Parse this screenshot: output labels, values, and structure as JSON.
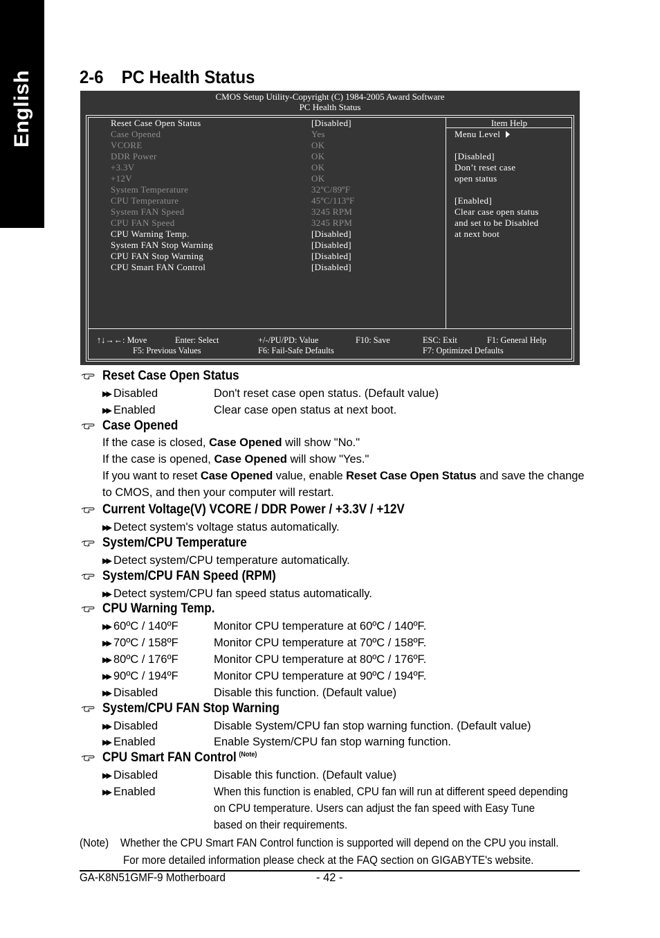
{
  "side_tab": {
    "label": "English"
  },
  "section": {
    "number": "2-6",
    "title": "PC Health Status"
  },
  "bios": {
    "header_line1": "CMOS Setup Utility-Copyright (C) 1984-2005 Award Software",
    "header_line2": "PC Health Status",
    "items": [
      {
        "label": "Reset Case Open Status",
        "value": "[Disabled]",
        "dim": false
      },
      {
        "label": "Case Opened",
        "value": "Yes",
        "dim": true
      },
      {
        "label": "VCORE",
        "value": "OK",
        "dim": true
      },
      {
        "label": "DDR Power",
        "value": "OK",
        "dim": true
      },
      {
        "label": "+3.3V",
        "value": "OK",
        "dim": true
      },
      {
        "label": "+12V",
        "value": "OK",
        "dim": true
      },
      {
        "label": "System Temperature",
        "value": "32ºC/89ºF",
        "dim": true
      },
      {
        "label": "CPU Temperature",
        "value": "45ºC/113ºF",
        "dim": true
      },
      {
        "label": "System FAN Speed",
        "value": "3245 RPM",
        "dim": true
      },
      {
        "label": "CPU FAN Speed",
        "value": "3245 RPM",
        "dim": true
      },
      {
        "label": "CPU Warning Temp.",
        "value": "[Disabled]",
        "dim": false
      },
      {
        "label": "System FAN Stop Warning",
        "value": "[Disabled]",
        "dim": false
      },
      {
        "label": "CPU FAN Stop Warning",
        "value": "[Disabled]",
        "dim": false
      },
      {
        "label": "CPU Smart FAN Control",
        "value": "[Disabled]",
        "dim": false
      }
    ],
    "help_title": "Item Help",
    "help_menu_level": "Menu Level",
    "help_lines": [
      "",
      "[Disabled]",
      "Don’t reset case",
      "open status",
      "",
      "[Enabled]",
      "Clear case open status",
      "and set to be Disabled",
      "at next boot"
    ],
    "footer": {
      "move": "↑↓→←: Move",
      "select": "Enter: Select",
      "value": "+/-/PU/PD: Value",
      "save": "F10: Save",
      "exit": "ESC: Exit",
      "help": "F1: General Help",
      "previous": "F5: Previous Values",
      "failsafe": "F6: Fail-Safe Defaults",
      "optimized": "F7: Optimized Defaults"
    }
  },
  "doc": {
    "reset_case": {
      "heading": "Reset Case Open Status",
      "options": [
        {
          "name": "Disabled",
          "desc": "Don't reset case open status. (Default value)"
        },
        {
          "name": "Enabled",
          "desc": "Clear case open status at next boot."
        }
      ]
    },
    "case_opened": {
      "heading": "Case Opened",
      "line1_a": "If the case is closed, ",
      "line1_b": "Case Opened",
      "line1_c": " will show \"No.\"",
      "line2_a": "If the case is opened, ",
      "line2_b": "Case Opened",
      "line2_c": " will show \"Yes.\"",
      "line3_a": "If you want to reset ",
      "line3_b": "Case Opened",
      "line3_c": " value, enable ",
      "line3_d": "Reset Case Open Status",
      "line3_e": " and save the change",
      "line4": "to CMOS, and then your computer will restart."
    },
    "voltage": {
      "heading": "Current Voltage(V) VCORE / DDR Power / +3.3V / +12V",
      "detail": "Detect system's voltage status automatically."
    },
    "temperature": {
      "heading": "System/CPU Temperature",
      "detail": "Detect system/CPU temperature automatically."
    },
    "fan_speed": {
      "heading": "System/CPU FAN Speed (RPM)",
      "detail": "Detect system/CPU fan speed status automatically."
    },
    "warning_temp": {
      "heading": "CPU Warning Temp.",
      "options": [
        {
          "name": "60ºC / 140ºF",
          "desc": "Monitor CPU temperature at 60ºC / 140ºF."
        },
        {
          "name": "70ºC / 158ºF",
          "desc": "Monitor CPU temperature at 70ºC / 158ºF."
        },
        {
          "name": "80ºC / 176ºF",
          "desc": "Monitor CPU temperature at 80ºC / 176ºF."
        },
        {
          "name": "90ºC / 194ºF",
          "desc": "Monitor CPU temperature at 90ºC / 194ºF."
        },
        {
          "name": "Disabled",
          "desc": "Disable this function. (Default value)"
        }
      ]
    },
    "fan_stop": {
      "heading": "System/CPU FAN Stop Warning",
      "options": [
        {
          "name": "Disabled",
          "desc": "Disable System/CPU fan stop warning function. (Default value)"
        },
        {
          "name": "Enabled",
          "desc": "Enable System/CPU fan stop warning function."
        }
      ]
    },
    "smart_fan": {
      "heading": "CPU Smart FAN Control",
      "note_marker": "(Note)",
      "options": [
        {
          "name": "Disabled",
          "desc": "Disable this function. (Default value)"
        },
        {
          "name": "Enabled",
          "desc": "When this function is enabled, CPU fan will run at different speed depending"
        }
      ],
      "enabled_cont1": "on CPU temperature. Users can adjust the fan speed with Easy Tune",
      "enabled_cont2": "based on their requirements."
    },
    "note": {
      "label": "(Note)",
      "line1": "Whether the CPU Smart FAN Control function is supported will depend on the CPU you install.",
      "line2": "For more detailed information please check at the FAQ section on GIGABYTE's website."
    }
  },
  "footer": {
    "model": "GA-K8N51GMF-9 Motherboard",
    "page": "- 42 -"
  }
}
